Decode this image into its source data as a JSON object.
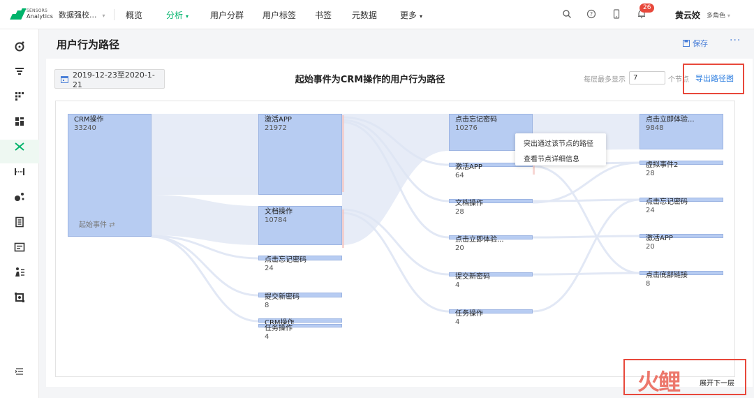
{
  "brand": {
    "line1": "SENSORS",
    "line2": "Analytics"
  },
  "topnav": {
    "project": "数据强校...",
    "items": [
      {
        "label": "概览",
        "active": false,
        "dropdown": false
      },
      {
        "label": "分析",
        "active": true,
        "dropdown": true
      },
      {
        "label": "用户分群",
        "active": false,
        "dropdown": false
      },
      {
        "label": "用户标签",
        "active": false,
        "dropdown": false
      },
      {
        "label": "书签",
        "active": false,
        "dropdown": false
      },
      {
        "label": "元数据",
        "active": false,
        "dropdown": false
      },
      {
        "label": "更多",
        "active": false,
        "dropdown": true
      }
    ],
    "icons": [
      "search-icon",
      "help-icon",
      "mobile-icon",
      "bell-icon"
    ],
    "notification_count": "26",
    "user": "黄云姣",
    "role": "多角色"
  },
  "sidebar": {
    "icons": [
      "dashboard-icon",
      "funnel-icon",
      "retention-icon",
      "distribution-icon",
      "path-icon",
      "interval-icon",
      "attribution-icon",
      "report-icon",
      "list-icon",
      "user-sequence-icon",
      "settings-icon",
      "collapse-icon"
    ],
    "active": "path-icon"
  },
  "page": {
    "title": "用户行为路径",
    "save_label": "保存",
    "more_label": "···"
  },
  "toolbar": {
    "date_range": "2019-12-23至2020-1-21",
    "chart_title": "起始事件为CRM操作的用户行为路径",
    "per_layer_label": "每层最多显示",
    "per_layer_value": "7",
    "nodes_label": "个节点",
    "export_label": "导出路径图"
  },
  "chart": {
    "start_event_label": "起始事件",
    "columns": [
      [
        {
          "label": "CRM操作",
          "count": "33240"
        }
      ],
      [
        {
          "label": "激活APP",
          "count": "21972"
        },
        {
          "label": "文档操作",
          "count": "10784"
        },
        {
          "label": "点击忘记密码",
          "count": "24"
        },
        {
          "label": "提交新密码",
          "count": "8"
        },
        {
          "label": "CRM操作",
          "count": ""
        },
        {
          "label": "任务操作",
          "count": "4"
        }
      ],
      [
        {
          "label": "点击忘记密码",
          "count": "10276"
        },
        {
          "label": "激活APP",
          "count": "64"
        },
        {
          "label": "文档操作",
          "count": "28"
        },
        {
          "label": "点击立即体验...",
          "count": "20"
        },
        {
          "label": "提交新密码",
          "count": "4"
        },
        {
          "label": "任务操作",
          "count": "4"
        }
      ],
      [
        {
          "label": "点击立即体验...",
          "count": "9848"
        },
        {
          "label": "虚拟事件2",
          "count": "28"
        },
        {
          "label": "点击忘记密码",
          "count": "24"
        },
        {
          "label": "激活APP",
          "count": "20"
        },
        {
          "label": "点击底部链接",
          "count": "8"
        }
      ]
    ],
    "context_menu": [
      "突出通过该节点的路径",
      "查看节点详细信息"
    ],
    "expand_label": "展开下一层"
  },
  "colors": {
    "accent": "#00b36b",
    "link": "#2f7fe0",
    "node": "#b7ccf2",
    "highlight": "#e8483b"
  },
  "watermark": "火鲤"
}
